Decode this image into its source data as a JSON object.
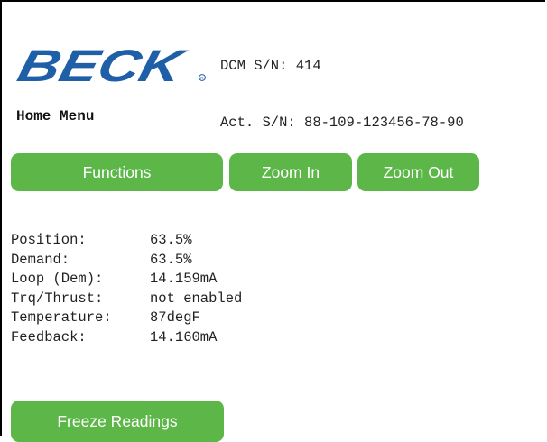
{
  "brand": {
    "logo_text": "BECK"
  },
  "header": {
    "dcm_serial_label": "DCM S/N:",
    "dcm_serial": "414",
    "actuator_serial_label": "Act. S/N:",
    "actuator_serial": "88-109-123456-78-90"
  },
  "menu": {
    "title": "Home Menu"
  },
  "buttons": {
    "functions": "Functions",
    "zoom_in": "Zoom In",
    "zoom_out": "Zoom Out",
    "freeze": "Freeze Readings"
  },
  "readings": [
    {
      "label": "Position:",
      "value": "63.5%"
    },
    {
      "label": "Demand:",
      "value": "63.5%"
    },
    {
      "label": "Loop (Dem):",
      "value": "14.159mA"
    },
    {
      "label": "Trq/Thrust:",
      "value": "not enabled"
    },
    {
      "label": "Temperature:",
      "value": "87degF"
    },
    {
      "label": "Feedback:",
      "value": "14.160mA"
    }
  ],
  "colors": {
    "button": "#5cb648",
    "logo": "#1f5fa8"
  }
}
